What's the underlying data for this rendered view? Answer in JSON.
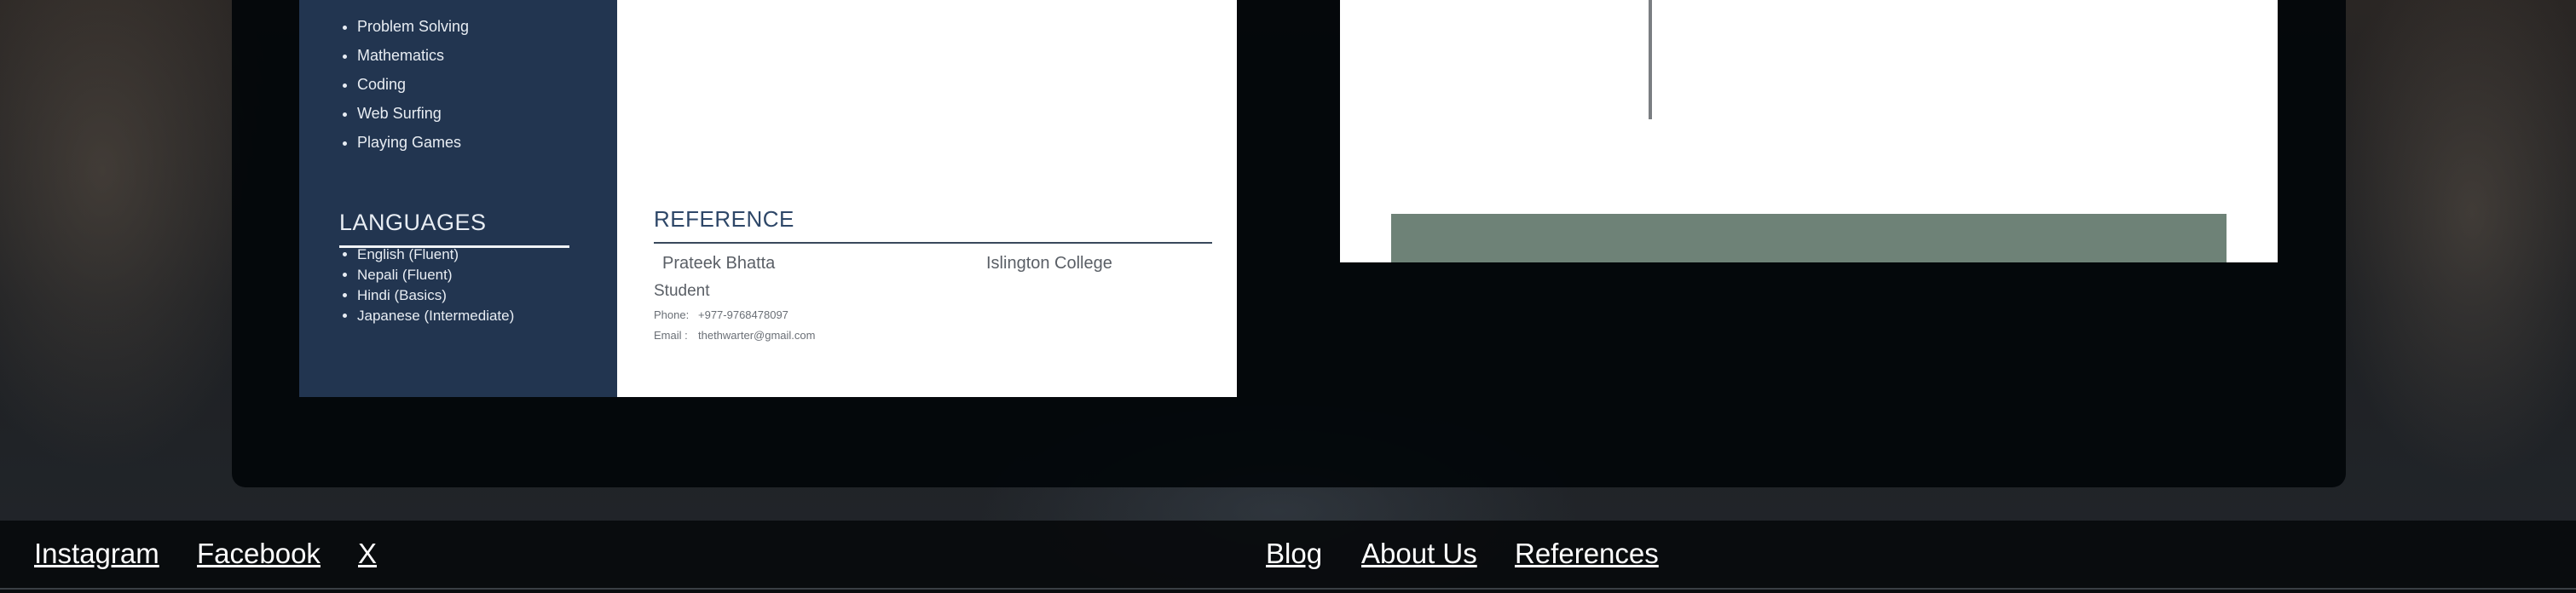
{
  "hobbies": [
    "Problem Solving",
    "Mathematics",
    "Coding",
    "Web Surfing",
    "Playing Games"
  ],
  "languages": {
    "title": "LANGUAGES",
    "items": [
      "English (Fluent)",
      "Nepali (Fluent)",
      "Hindi (Basics)",
      "Japanese (Intermediate)"
    ]
  },
  "reference": {
    "title": "REFERENCE",
    "name": "Prateek Bhatta",
    "organization": "Islington College",
    "role": "Student",
    "phone_label": "Phone:",
    "phone": "+977-9768478097",
    "email_label": "Email :",
    "email": "thethwarter@gmail.com"
  },
  "footer": {
    "social": [
      "Instagram",
      "Facebook",
      "X"
    ],
    "nav": [
      "Blog",
      "About Us",
      "References"
    ]
  },
  "colors": {
    "sidebar": "#223550",
    "heading": "#2e4768",
    "accent_bar": "#6e8277"
  }
}
